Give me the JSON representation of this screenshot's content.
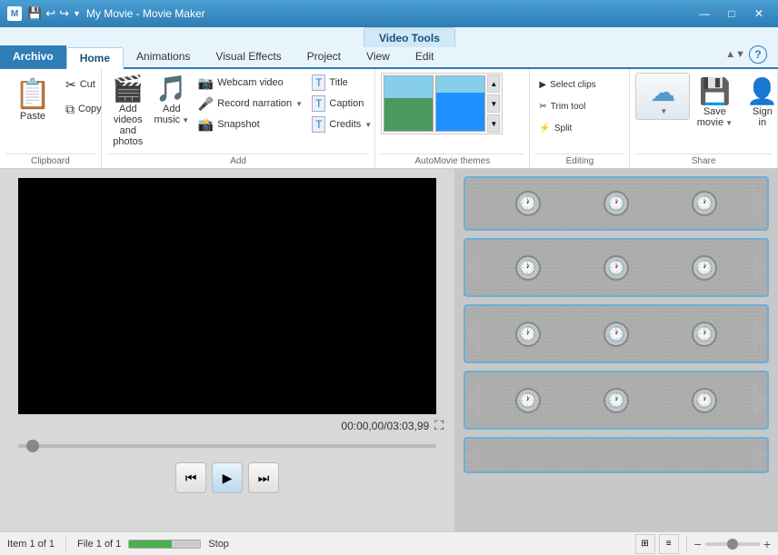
{
  "titleBar": {
    "title": "My Movie - Movie Maker",
    "quickAccess": [
      "💾",
      "↩",
      "↪"
    ],
    "controls": [
      "—",
      "□",
      "✕"
    ]
  },
  "videoToolsTab": {
    "label": "Video Tools"
  },
  "ribbonTabs": [
    {
      "id": "archivo",
      "label": "Archivo",
      "active": false,
      "special": true
    },
    {
      "id": "home",
      "label": "Home",
      "active": true
    },
    {
      "id": "animations",
      "label": "Animations",
      "active": false
    },
    {
      "id": "visual-effects",
      "label": "Visual Effects",
      "active": false
    },
    {
      "id": "project",
      "label": "Project",
      "active": false
    },
    {
      "id": "view",
      "label": "View",
      "active": false
    },
    {
      "id": "edit",
      "label": "Edit",
      "active": false
    }
  ],
  "ribbon": {
    "groups": {
      "clipboard": {
        "label": "Clipboard",
        "paste": "Paste",
        "cut": "✂",
        "copy": "⧉",
        "cutLabel": "Cut",
        "copyLabel": "Copy"
      },
      "add": {
        "label": "Add",
        "addVideos": "Add videos",
        "andPhotos": "and photos",
        "addMusic": "Add",
        "music": "music",
        "webcamVideo": "Webcam video",
        "recordNarration": "Record narration",
        "snapshot": "Snapshot",
        "title": "Title",
        "caption": "Caption",
        "credits": "Credits"
      },
      "autoMovie": {
        "label": "AutoMovie themes"
      },
      "editing": {
        "label": "Editing",
        "title": "Editing"
      },
      "share": {
        "label": "Share",
        "saveMovie": "Save",
        "movie": "movie",
        "signIn": "Sign",
        "in": "in"
      }
    }
  },
  "preview": {
    "timeDisplay": "00:00,00/03:03,99"
  },
  "statusBar": {
    "item": "Item 1 of 1",
    "file": "File 1 of 1",
    "stop": "Stop"
  },
  "controls": {
    "rewind": "⏮",
    "play": "▶",
    "forward": "⏭"
  }
}
